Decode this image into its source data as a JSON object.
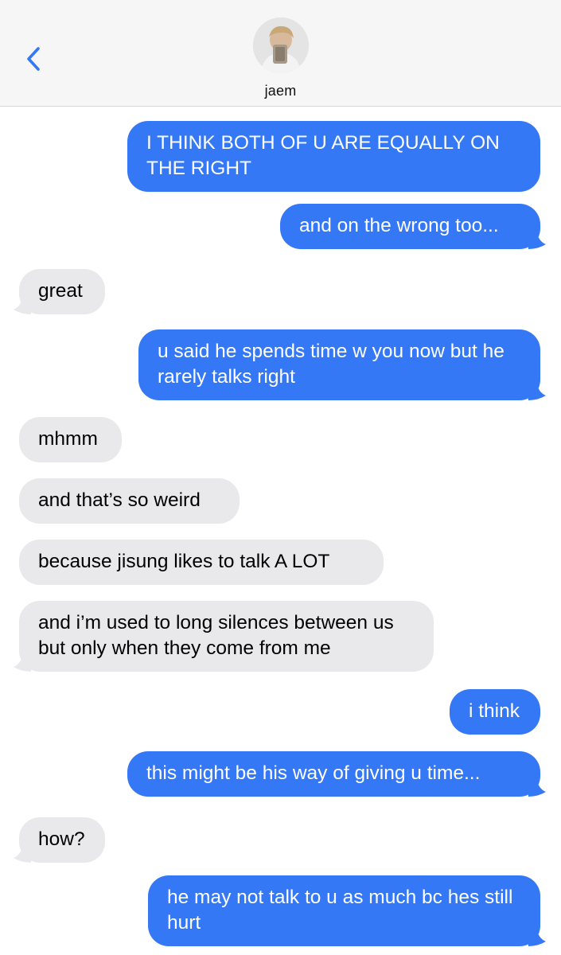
{
  "header": {
    "back_icon": "chevron-left-icon",
    "contact_name": "jaem",
    "accent": "#3478f6"
  },
  "messages": [
    {
      "from": "me",
      "text": "I THINK BOTH OF U ARE EQUALLY ON THE RIGHT"
    },
    {
      "from": "me",
      "text": "and on the wrong too..."
    },
    {
      "from": "them",
      "text": "great"
    },
    {
      "from": "me",
      "text": "u said he spends time w you now but he rarely talks right"
    },
    {
      "from": "them",
      "text": "mhmm"
    },
    {
      "from": "them",
      "text": "and that’s so weird"
    },
    {
      "from": "them",
      "text": "because jisung likes to talk A LOT"
    },
    {
      "from": "them",
      "text": "and i’m used to long silences between us but only when they come from me"
    },
    {
      "from": "me",
      "text": "i think"
    },
    {
      "from": "me",
      "text": "this might be his way of giving u time..."
    },
    {
      "from": "them",
      "text": "how?"
    },
    {
      "from": "me",
      "text": "he may not talk to u as much bc hes still hurt"
    }
  ],
  "colors": {
    "outgoing_bubble": "#3478f6",
    "incoming_bubble": "#e9e9eb"
  }
}
